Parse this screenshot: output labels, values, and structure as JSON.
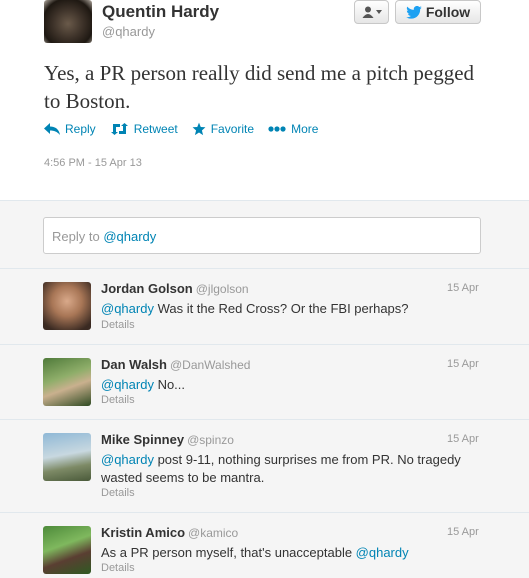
{
  "tweet": {
    "author_name": "Quentin Hardy",
    "author_handle": "@qhardy",
    "text": "Yes, a PR person really did send me a pitch pegged to Boston.",
    "timestamp": "4:56 PM - 15 Apr 13",
    "actions": {
      "reply": "Reply",
      "retweet": "Retweet",
      "favorite": "Favorite",
      "more": "More"
    }
  },
  "header_buttons": {
    "follow": "Follow"
  },
  "reply_box": {
    "prefix": "Reply to",
    "mention": "@qhardy"
  },
  "replies": [
    {
      "name": "Jordan Golson",
      "handle": "@jlgolson",
      "date": "15 Apr",
      "mention": "@qhardy",
      "text": " Was it the Red Cross? Or the FBI perhaps?",
      "details": "Details"
    },
    {
      "name": "Dan Walsh",
      "handle": "@DanWalshed",
      "date": "15 Apr",
      "mention": "@qhardy",
      "text": " No...",
      "details": "Details"
    },
    {
      "name": "Mike Spinney",
      "handle": "@spinzo",
      "date": "15 Apr",
      "mention": "@qhardy",
      "text": " post 9-11, nothing surprises me from PR. No tragedy wasted seems to be mantra.",
      "details": "Details"
    },
    {
      "name": "Kristin Amico",
      "handle": "@kamico",
      "date": "15 Apr",
      "text": "As a PR person myself, that's unacceptable ",
      "mention": "@qhardy",
      "details": "Details"
    }
  ],
  "colors": {
    "link": "#0084b4",
    "muted": "#999999",
    "text": "#333333",
    "background": "#f5f5f5"
  }
}
